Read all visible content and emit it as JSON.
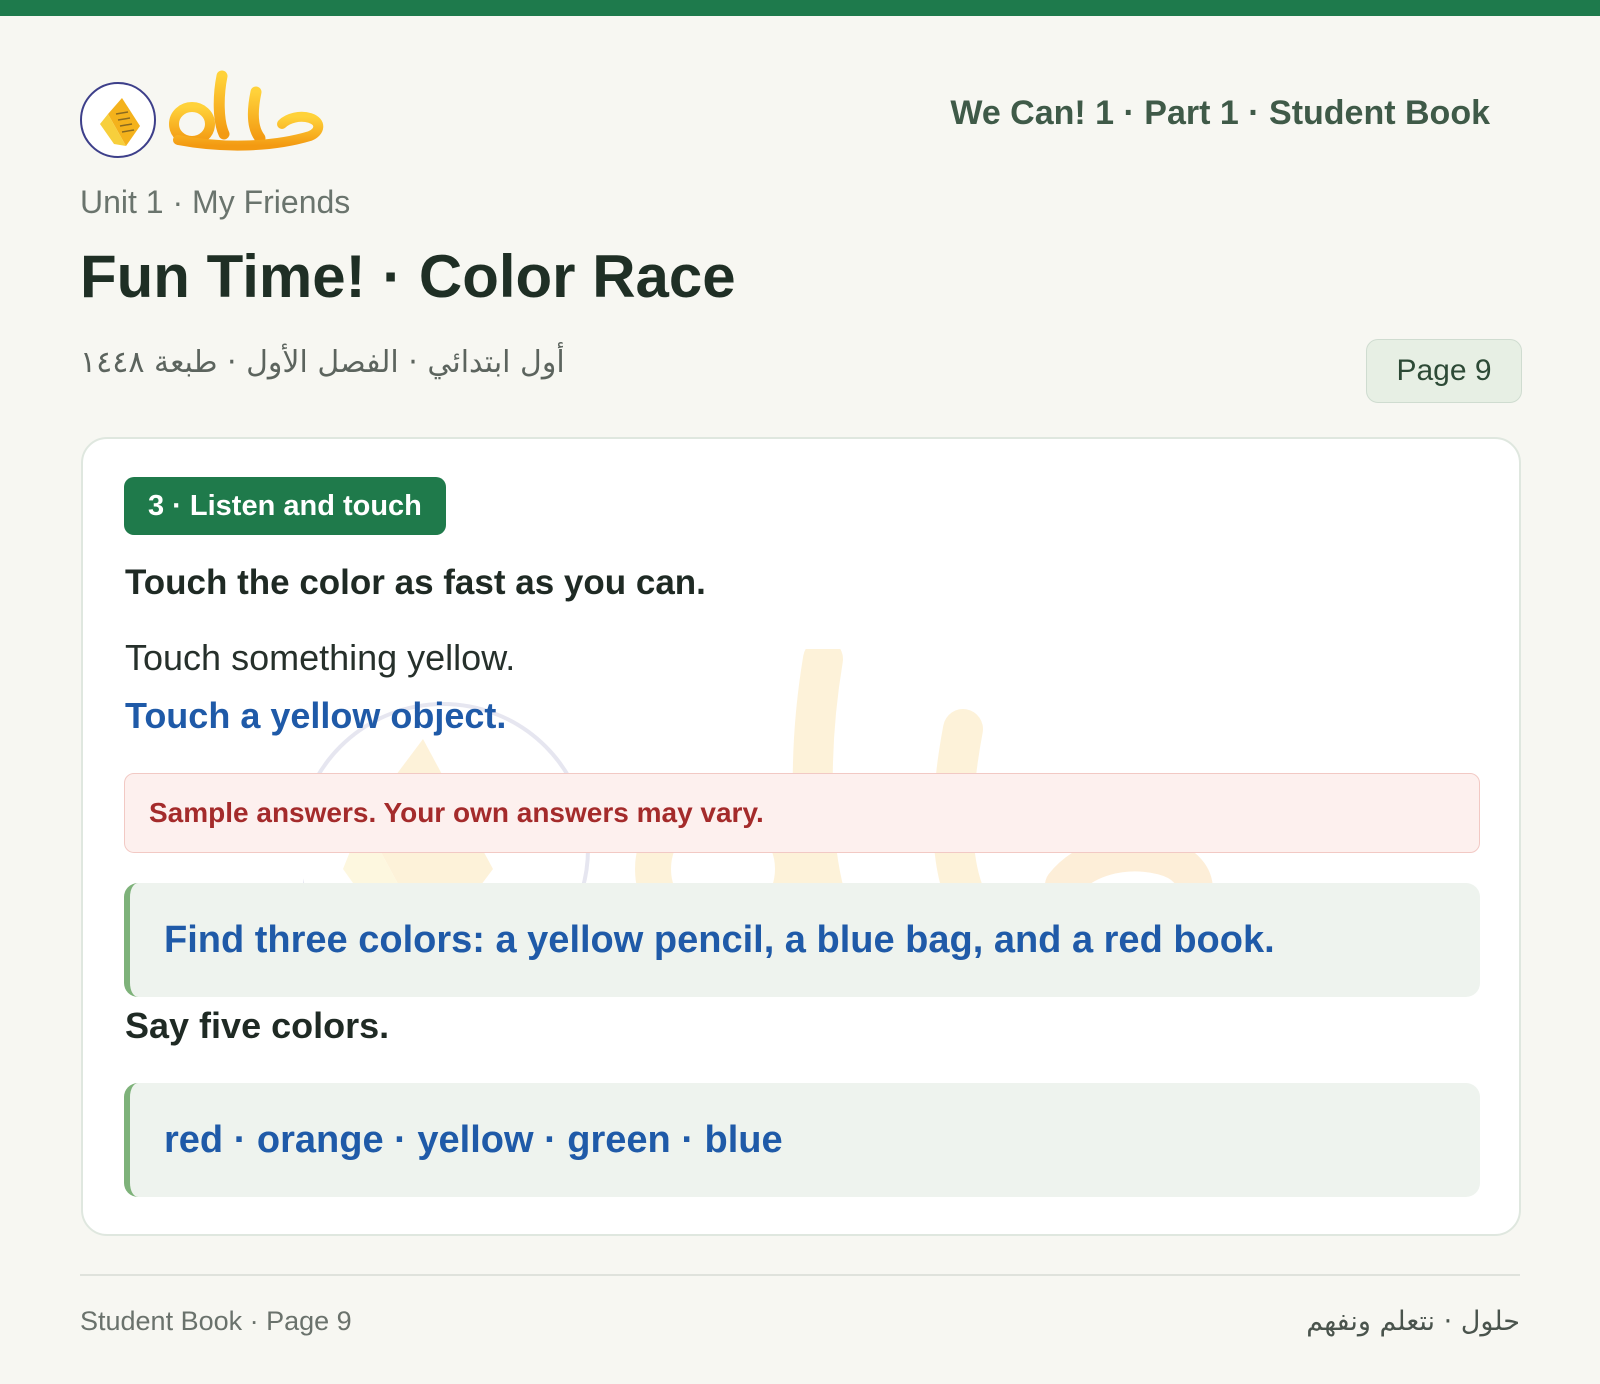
{
  "header": {
    "logo_text": "حلول",
    "book_title": "We Can! 1 · Part 1 · Student Book"
  },
  "lesson": {
    "unit": "Unit 1 · My Friends",
    "title": "Fun Time! · Color Race",
    "arabic_meta": "أول ابتدائي · الفصل الأول · طبعة ١٤٤٨",
    "page_label": "Page 9"
  },
  "exercise": {
    "badge": "3 · Listen and touch",
    "instruction": "Touch the color as fast as you can.",
    "prompt": "Touch something yellow.",
    "answer": "Touch a yellow object.",
    "note": "Sample answers. Your own answers may vary.",
    "answer_box_1": "Find three colors: a yellow pencil, a blue bag, and a red book.",
    "say_prompt": "Say five colors.",
    "answer_box_2": "red · orange · yellow · green · blue"
  },
  "footer": {
    "left": "Student Book · Page 9",
    "right": "حلول · نتعلم ونفهم"
  },
  "colors": {
    "brand_green": "#1e7a4c",
    "answer_blue": "#1f5aa8",
    "note_red": "#a42b2b",
    "logo_orange": "#f5a21a"
  }
}
